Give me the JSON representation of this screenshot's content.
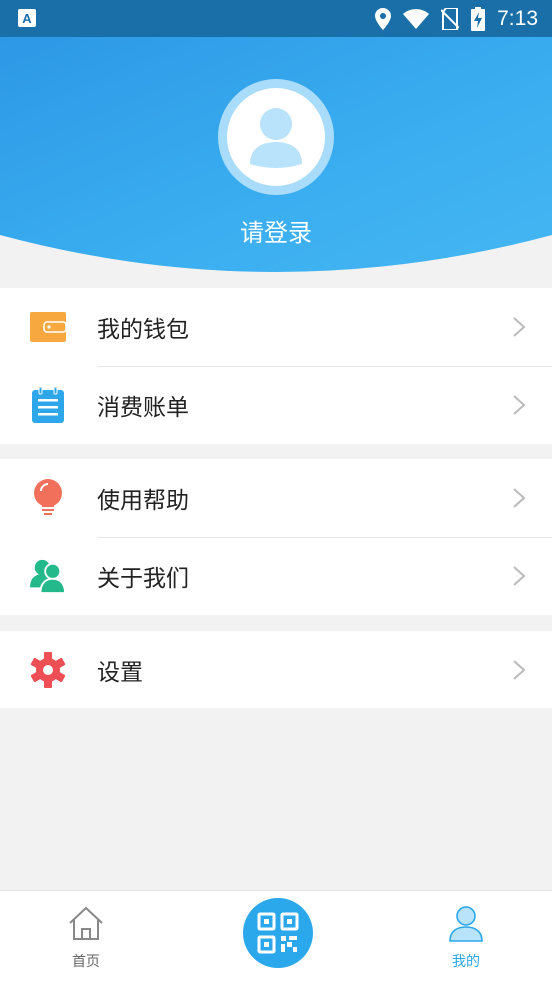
{
  "status_bar": {
    "time": "7:13"
  },
  "header": {
    "login_label": "请登录"
  },
  "menu_groups": [
    [
      {
        "label": "我的钱包",
        "icon": "wallet-icon",
        "color": "#f7a93f"
      },
      {
        "label": "消费账单",
        "icon": "bill-icon",
        "color": "#2ea6ea"
      }
    ],
    [
      {
        "label": "使用帮助",
        "icon": "lightbulb-icon",
        "color": "#f0705c"
      },
      {
        "label": "关于我们",
        "icon": "people-icon",
        "color": "#23b98a"
      }
    ],
    [
      {
        "label": "设置",
        "icon": "gear-icon",
        "color": "#ee4f55"
      }
    ]
  ],
  "tab_bar": {
    "home_label": "首页",
    "scan_icon": "qr-code-icon",
    "mine_label": "我的"
  },
  "colors": {
    "accent": "#2aa8ea",
    "header_top": "#2e9ee8",
    "status_bar": "#1a6fa8"
  }
}
